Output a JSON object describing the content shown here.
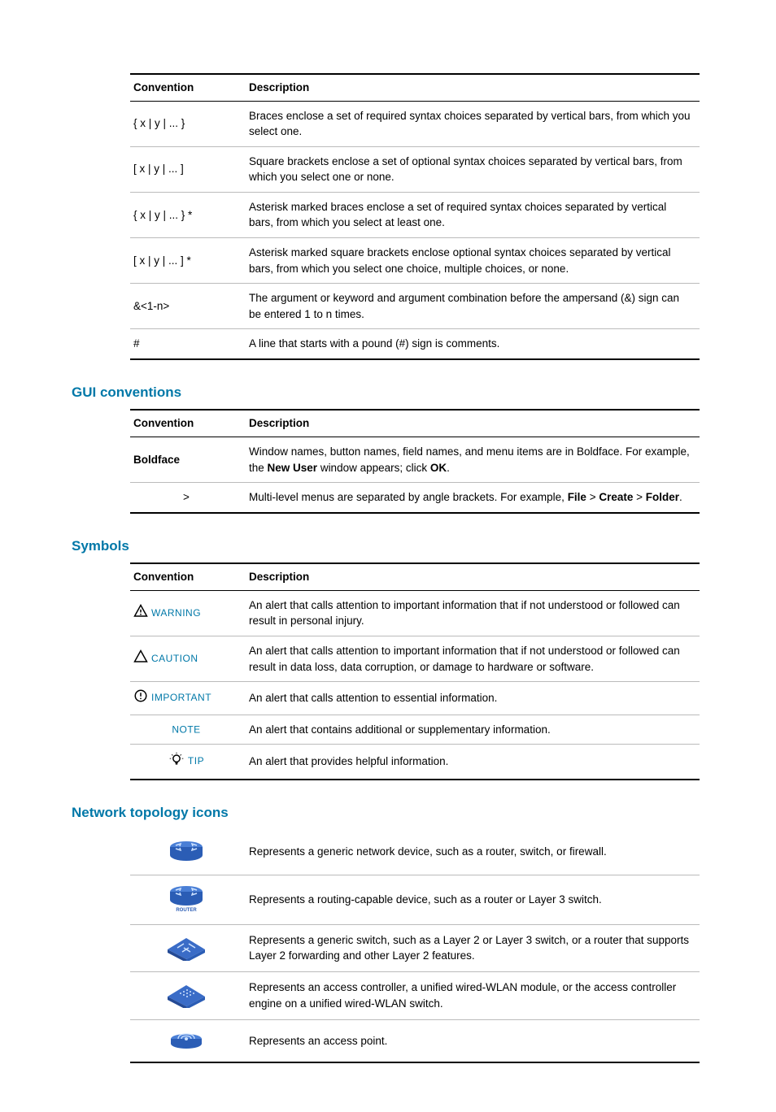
{
  "tables": {
    "syntax": {
      "headers": [
        "Convention",
        "Description"
      ],
      "rows": [
        {
          "conv": "{ x | y | ... }",
          "desc": "Braces enclose a set of required syntax choices separated by vertical bars, from which you select one."
        },
        {
          "conv": "[ x | y | ... ]",
          "desc": "Square brackets enclose a set of optional syntax choices separated by vertical bars, from which you select one or none."
        },
        {
          "conv": "{ x | y | ... } *",
          "desc": "Asterisk marked braces enclose a set of required syntax choices separated by vertical bars, from which you select at least one."
        },
        {
          "conv": "[ x | y | ... ] *",
          "desc": "Asterisk marked square brackets enclose optional syntax choices separated by vertical bars, from which you select one choice, multiple choices, or none."
        },
        {
          "conv": "&<1-n>",
          "desc": "The argument or keyword and argument combination before the ampersand (&) sign can be entered 1 to n times."
        },
        {
          "conv": "#",
          "desc": "A line that starts with a pound (#) sign is comments."
        }
      ]
    },
    "gui": {
      "title": "GUI conventions",
      "headers": [
        "Convention",
        "Description"
      ],
      "rows": [
        {
          "conv": "Boldface",
          "desc_pre": "Window names, button names, field names, and menu items are in Boldface. For example, the ",
          "b1": "New User",
          "mid": " window appears; click ",
          "b2": "OK",
          "post": "."
        },
        {
          "conv": ">",
          "desc_pre": "Multi-level menus are separated by angle brackets. For example, ",
          "b1": "File",
          "mid": " > ",
          "b2": "Create",
          "mid2": " > ",
          "b3": "Folder",
          "post": "."
        }
      ]
    },
    "symbols": {
      "title": "Symbols",
      "headers": [
        "Convention",
        "Description"
      ],
      "rows": [
        {
          "label": "WARNING",
          "desc": "An alert that calls attention to important information that if not understood or followed can result in personal injury."
        },
        {
          "label": "CAUTION",
          "desc": "An alert that calls attention to important information that if not understood or followed can result in data loss, data corruption, or damage to hardware or software."
        },
        {
          "label": "IMPORTANT",
          "desc": "An alert that calls attention to essential information."
        },
        {
          "label": "NOTE",
          "desc": "An alert that contains additional or supplementary information."
        },
        {
          "label": "TIP",
          "desc": "An alert that provides helpful information."
        }
      ]
    },
    "topology": {
      "title": "Network topology icons",
      "rows": [
        {
          "desc": "Represents a generic network device, such as a router, switch, or firewall."
        },
        {
          "desc": "Represents a routing-capable device, such as a router or Layer 3 switch."
        },
        {
          "desc": "Represents a generic switch, such as a Layer 2 or Layer 3 switch, or a router that supports Layer 2 forwarding and other Layer 2 features."
        },
        {
          "desc": "Represents an access controller, a unified wired-WLAN module, or the access controller engine on a unified wired-WLAN switch."
        },
        {
          "desc": "Represents an access point."
        }
      ]
    }
  }
}
